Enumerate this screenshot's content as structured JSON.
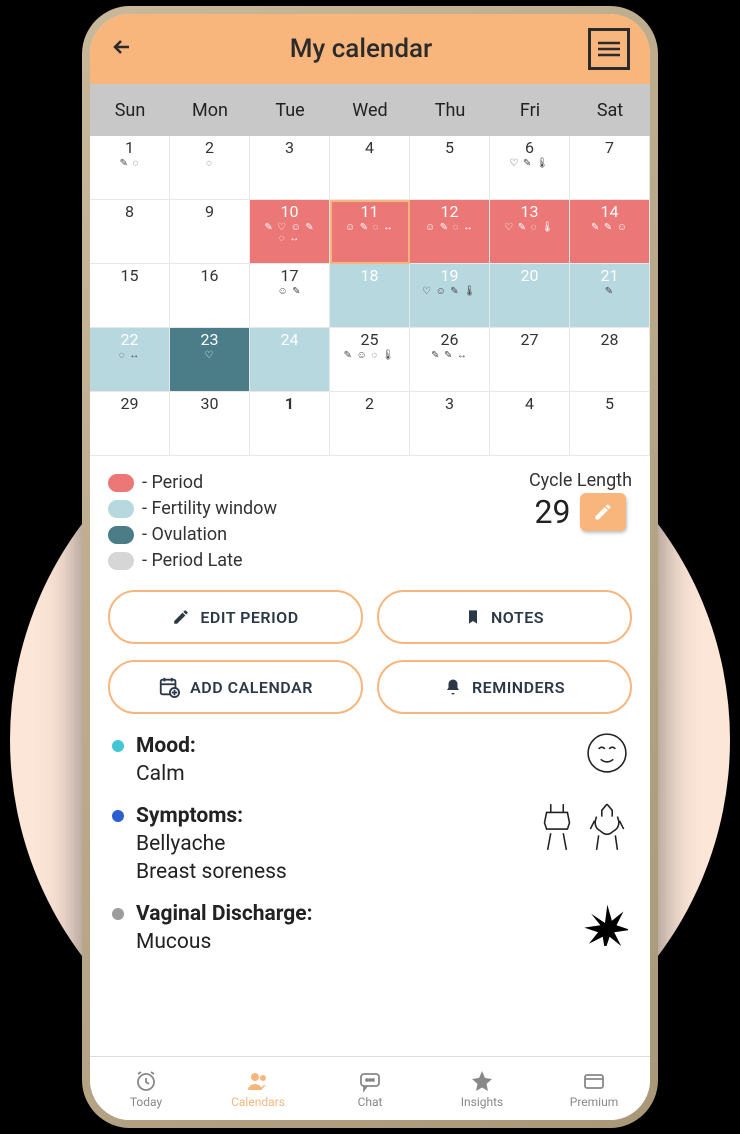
{
  "header": {
    "title": "My calendar"
  },
  "weekdays": [
    "Sun",
    "Mon",
    "Tue",
    "Wed",
    "Thu",
    "Fri",
    "Sat"
  ],
  "calendar": [
    [
      {
        "n": "1",
        "icons": "✎ ◌"
      },
      {
        "n": "2",
        "icons": "◌"
      },
      {
        "n": "3"
      },
      {
        "n": "4"
      },
      {
        "n": "5"
      },
      {
        "n": "6",
        "icons": "♡ ✎ 🌡"
      },
      {
        "n": "7"
      }
    ],
    [
      {
        "n": "8"
      },
      {
        "n": "9"
      },
      {
        "n": "10",
        "type": "period",
        "icons": "✎ ♡ ☺ ✎\n◌ ↔"
      },
      {
        "n": "11",
        "type": "period",
        "selected": true,
        "icons": "☺ ✎ ◌ ↔"
      },
      {
        "n": "12",
        "type": "period",
        "icons": "☺ ✎ ◌ ↔"
      },
      {
        "n": "13",
        "type": "period",
        "icons": "♡ ✎ ◌ 🌡"
      },
      {
        "n": "14",
        "type": "period",
        "icons": "✎ ✎ ☺"
      }
    ],
    [
      {
        "n": "15"
      },
      {
        "n": "16"
      },
      {
        "n": "17",
        "icons": "☺ ✎"
      },
      {
        "n": "18",
        "type": "fertility"
      },
      {
        "n": "19",
        "type": "fertility",
        "icons": "♡ ☺ ✎ 🌡"
      },
      {
        "n": "20",
        "type": "fertility"
      },
      {
        "n": "21",
        "type": "fertility",
        "icons": "✎"
      }
    ],
    [
      {
        "n": "22",
        "type": "fertility",
        "icons": "◌ ↔"
      },
      {
        "n": "23",
        "type": "ovulation",
        "icons": "♡"
      },
      {
        "n": "24",
        "type": "fertility"
      },
      {
        "n": "25",
        "icons": "✎ ☺ ◌ 🌡"
      },
      {
        "n": "26",
        "icons": "✎ ✎ ↔"
      },
      {
        "n": "27"
      },
      {
        "n": "28"
      }
    ],
    [
      {
        "n": "29"
      },
      {
        "n": "30"
      },
      {
        "n": "1",
        "bold": true
      },
      {
        "n": "2"
      },
      {
        "n": "3"
      },
      {
        "n": "4"
      },
      {
        "n": "5"
      }
    ]
  ],
  "legend": {
    "items": [
      {
        "color": "#ec7777",
        "label": "- Period"
      },
      {
        "color": "#b8d8e0",
        "label": "- Fertility window"
      },
      {
        "color": "#4a7d87",
        "label": "- Ovulation"
      },
      {
        "color": "#d6d6d6",
        "label": "- Period Late"
      }
    ]
  },
  "cycle": {
    "label": "Cycle Length",
    "value": "29"
  },
  "actions": {
    "edit_period": "EDIT PERIOD",
    "notes": "NOTES",
    "add_calendar": "ADD CALENDAR",
    "reminders": "REMINDERS"
  },
  "details": {
    "mood": {
      "title": "Mood:",
      "value": "Calm",
      "bullet": "#41c7d4"
    },
    "symptoms": {
      "title": "Symptoms:",
      "values": [
        "Bellyache",
        "Breast soreness"
      ],
      "bullet": "#2a5fd0"
    },
    "discharge": {
      "title": "Vaginal Discharge:",
      "value": "Mucous",
      "bullet": "#9c9c9c"
    }
  },
  "tabs": {
    "today": "Today",
    "calendars": "Calendars",
    "chat": "Chat",
    "insights": "Insights",
    "premium": "Premium"
  }
}
